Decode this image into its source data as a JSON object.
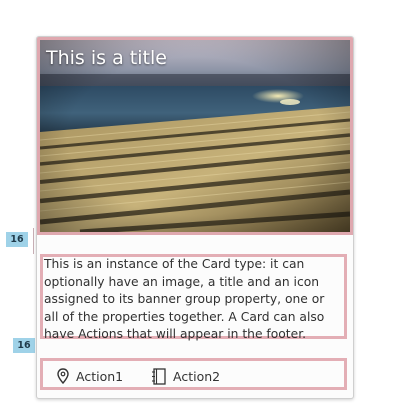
{
  "card": {
    "title": "This is a title",
    "content": "This is an instance of the Card type: it can optionally have an image, a title and an icon assigned to its banner group property, one or all of the properties together. A Card can also have Actions that will appear in the footer.",
    "actions": [
      {
        "label": "Action1",
        "icon": "location-pin-icon"
      },
      {
        "label": "Action2",
        "icon": "book-icon"
      }
    ]
  },
  "spacing_markers": [
    "16",
    "16"
  ],
  "colors": {
    "highlight_outline": "#d68c96",
    "spacing_badge": "#9fd2e8"
  }
}
